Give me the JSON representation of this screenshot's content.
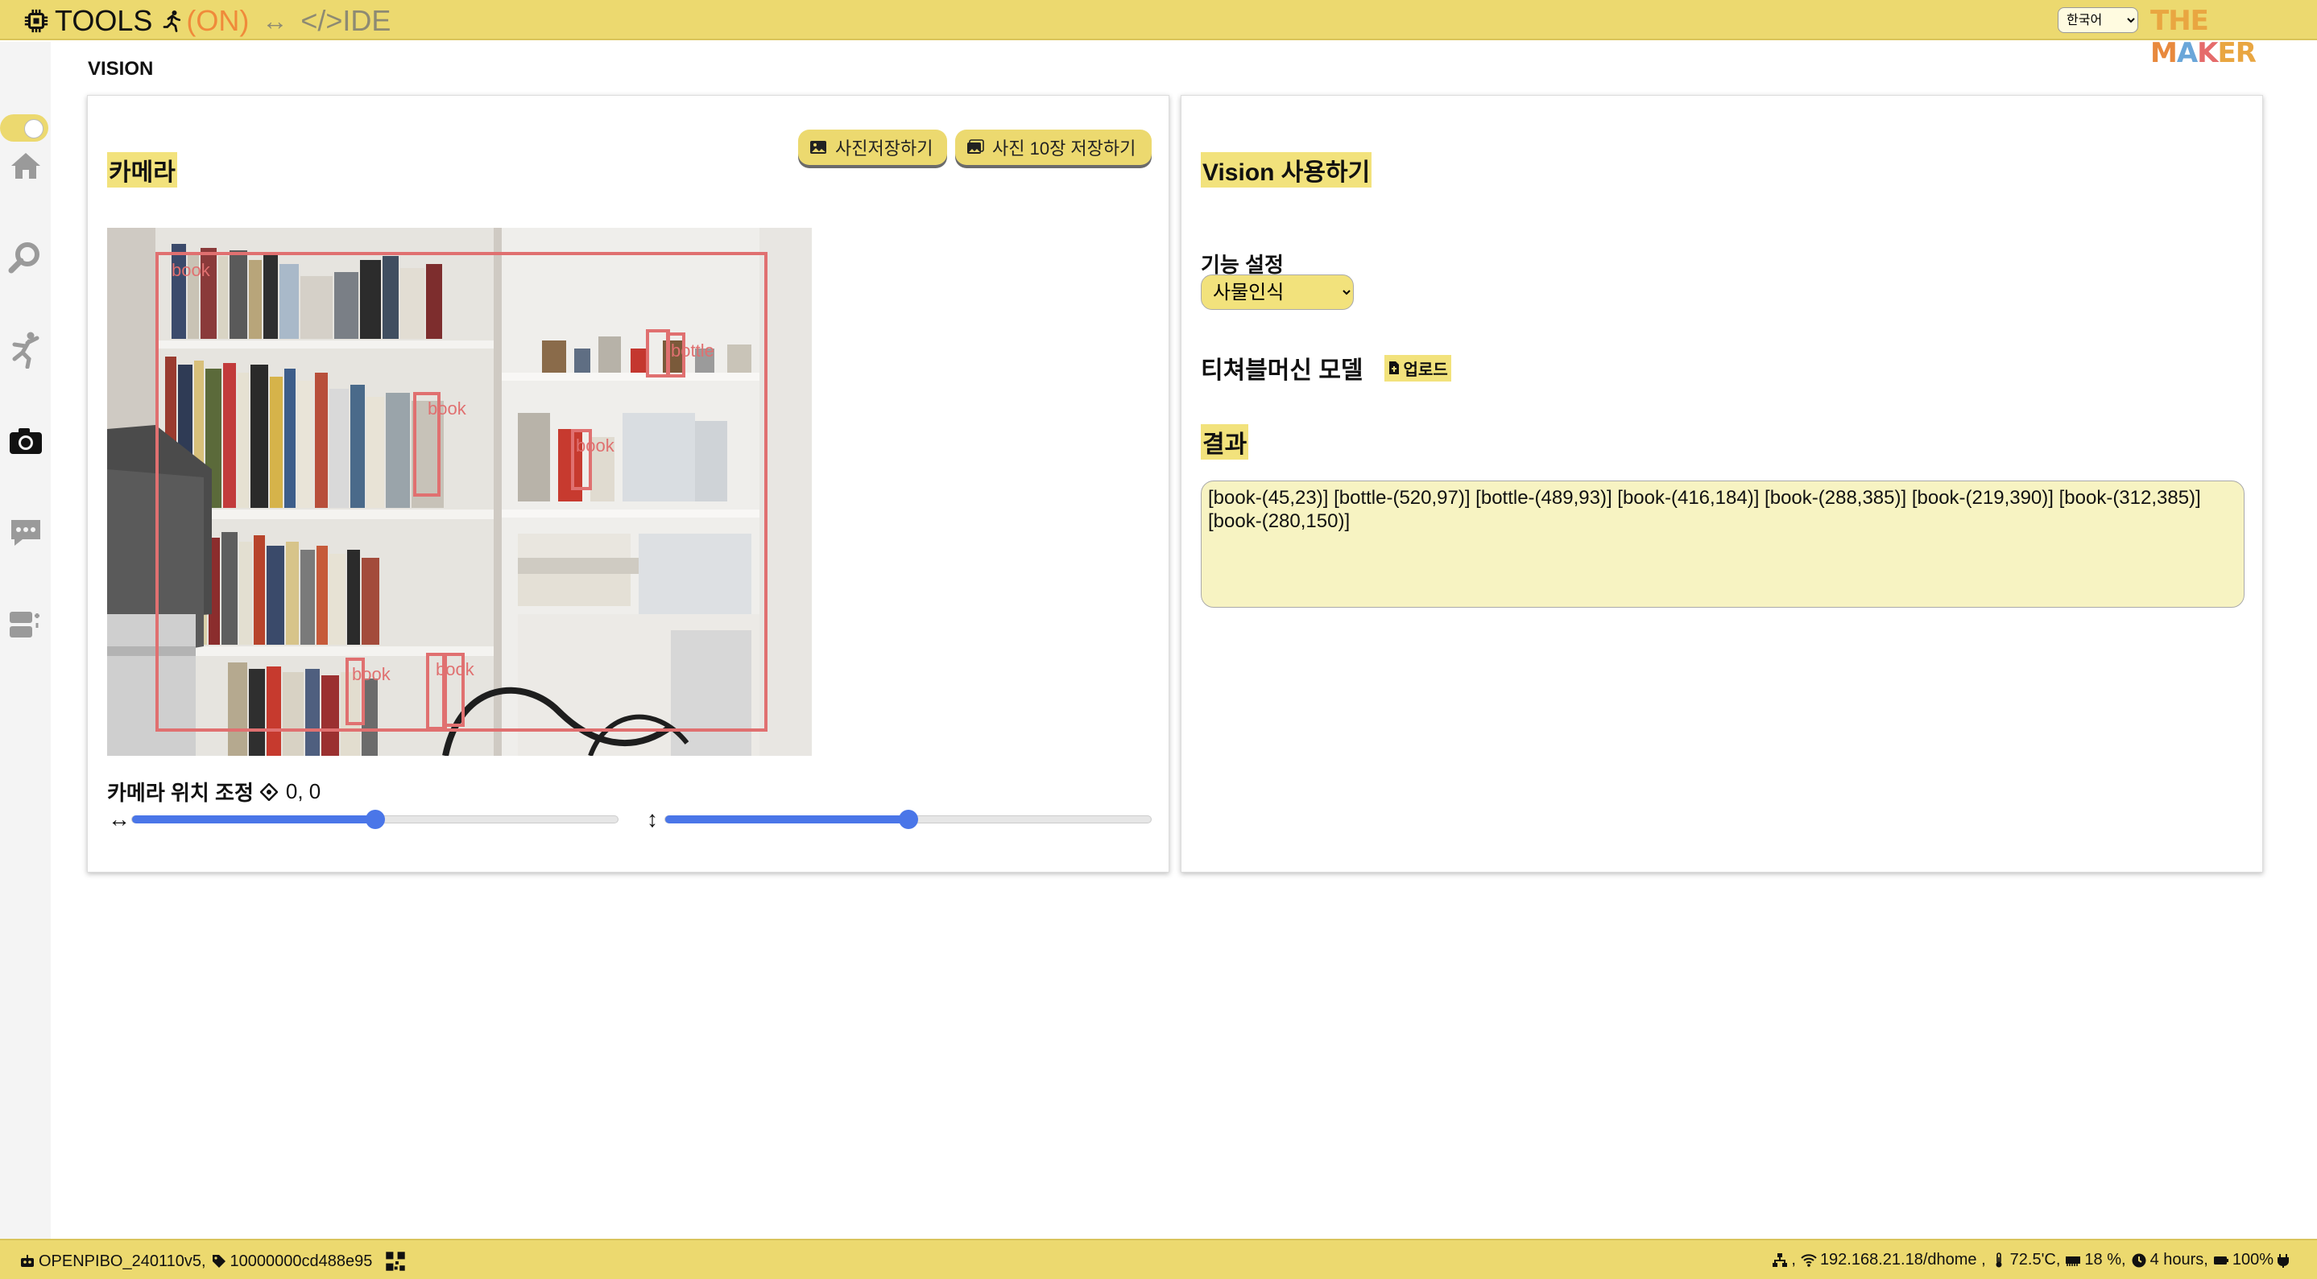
{
  "header": {
    "brand": "TOOLS",
    "status": "(ON)",
    "arrow": "↔",
    "ide": "</>IDE",
    "language": "한국어",
    "language_options": [
      "한국어"
    ],
    "logo": "THE MAKER"
  },
  "sidebar": {
    "items": [
      "home",
      "tools",
      "motion",
      "vision",
      "chat",
      "device"
    ]
  },
  "page": {
    "title": "VISION"
  },
  "camera_panel": {
    "title": "카메라",
    "save_button": "사진저장하기",
    "save10_button": "사진 10장 저장하기",
    "position_label": "카메라 위치 조정",
    "position_value": "0, 0",
    "h_arrow": "↔",
    "v_arrow": "↕",
    "h_slider": 0.5,
    "v_slider": 0.5,
    "detections": [
      {
        "label": "book"
      },
      {
        "label": "bottle"
      },
      {
        "label": "book"
      },
      {
        "label": "book"
      },
      {
        "label": "book"
      },
      {
        "label": "book"
      }
    ]
  },
  "vision_panel": {
    "title": "Vision 사용하기",
    "feature_label": "기능 설정",
    "feature_value": "사물인식",
    "teachable_label": "티쳐블머신 모델",
    "upload_label": "업로드",
    "result_label": "결과",
    "result_text": "[book-(45,23)] [bottle-(520,97)] [bottle-(489,93)] [book-(416,184)] [book-(288,385)] [book-(219,390)] [book-(312,385)] [book-(280,150)]"
  },
  "footer": {
    "device": "OPENPIBO_240110v5,",
    "serial": "10000000cd488e95",
    "network": "192.168.21.18/dhome ,",
    "temperature": "72.5'C,",
    "memory": "18 %,",
    "uptime": "4 hours,",
    "battery": "100%"
  },
  "colors": {
    "bar": "#ecd96f",
    "highlight": "#f2e27c",
    "slider": "#4a76e8",
    "detection_box": "#e07070"
  }
}
